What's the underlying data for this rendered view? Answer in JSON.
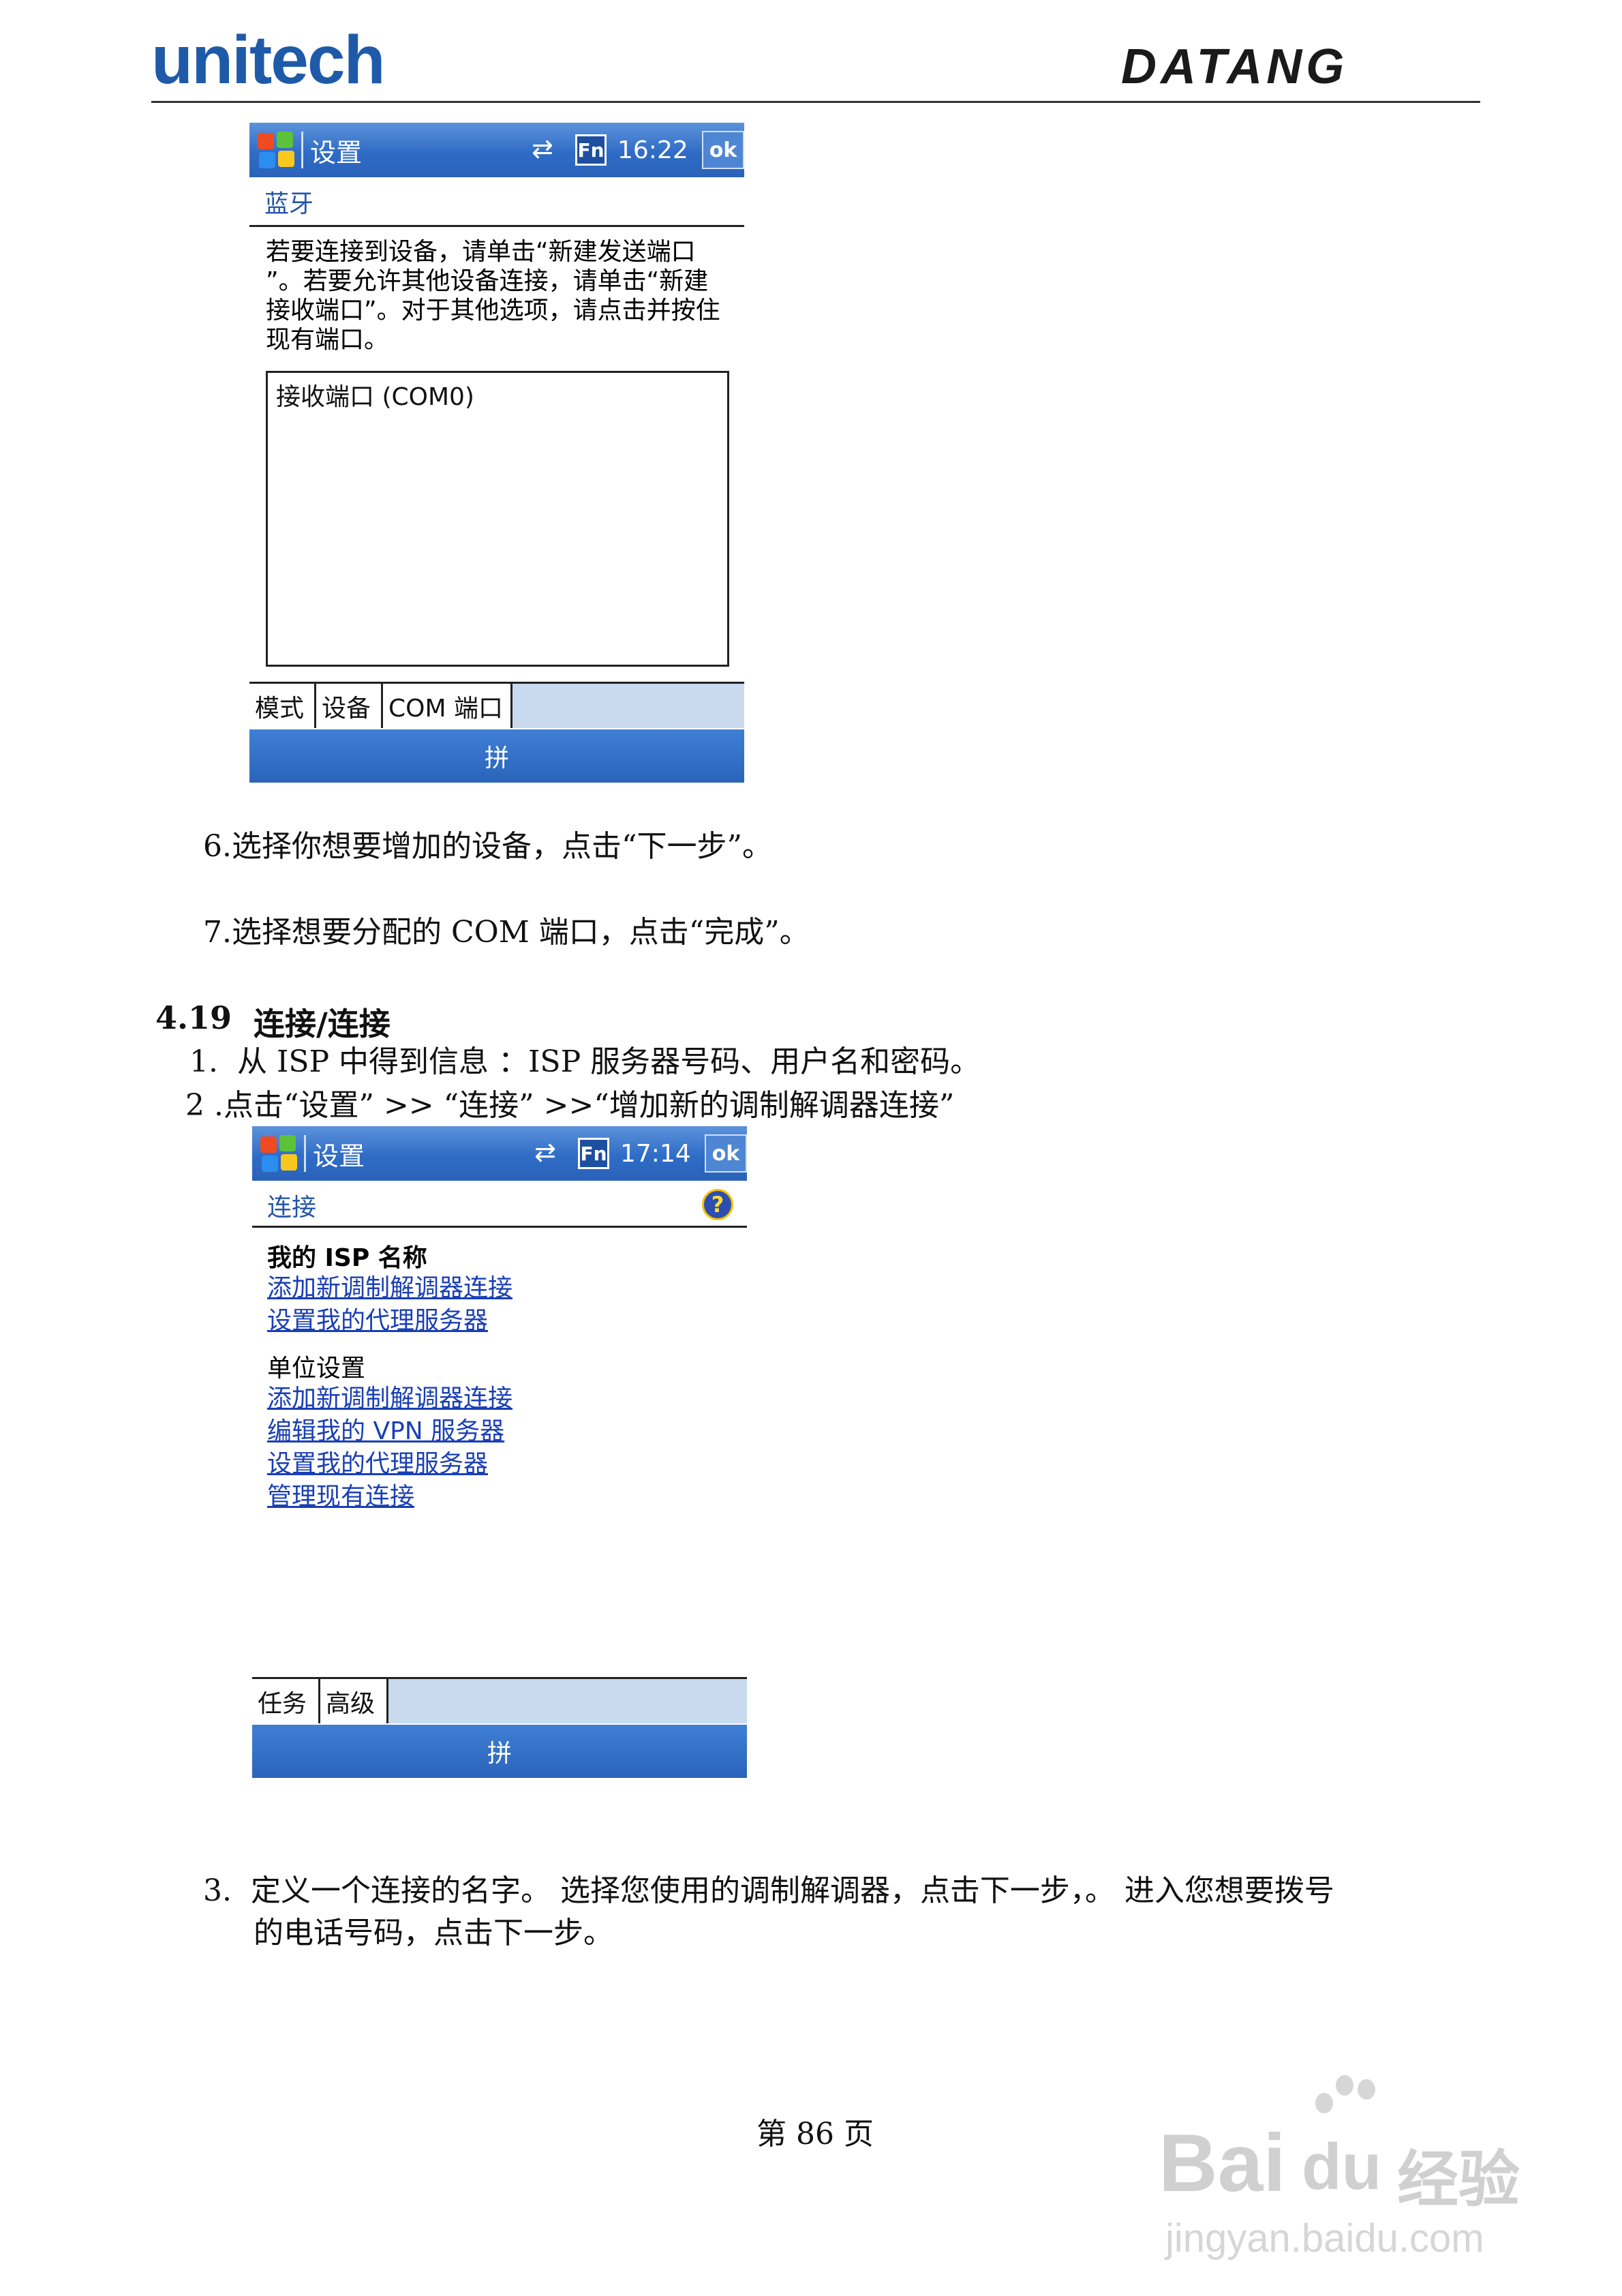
{
  "header": {
    "left_logo": "unitech",
    "right_logo": "DATANG"
  },
  "screen1": {
    "title": "设置",
    "sync_icon": "sync-arrows-icon",
    "fn_label": "Fn",
    "time": "16:22",
    "ok_label": "ok",
    "section": "蓝牙",
    "paragraph_lines": [
      "若要连接到设备，请单击“新建发送端口",
      "”。若要允许其他设备连接，请单击“新建",
      "接收端口”。对于其他选项，请点击并按住",
      "现有端口。"
    ],
    "list_item": "接收端口 (COM0)",
    "tabs": [
      "模式",
      "设备",
      "COM 端口"
    ],
    "menu": "拼"
  },
  "body": {
    "step6": "6.选择你想要增加的设备，点击“下一步”。",
    "step7": "7.选择想要分配的 COM 端口，点击“完成”。",
    "section_number": "4.19",
    "section_title": "连接/连接",
    "item1": "1.  从 ISP 中得到信息 ：ISP 服务器号码、用户名和密码。",
    "item2": "2 .点击“设置” >> “连接” >>“增加新的调制解调器连接”",
    "item3_line1": "3.  定义一个连接的名字。 选择您使用的调制解调器，点击下一步，。 进入您想要拨号",
    "item3_line2": "的电话号码，点击下一步。"
  },
  "screen2": {
    "title": "设置",
    "fn_label": "Fn",
    "time": "17:14",
    "ok_label": "ok",
    "section": "连接",
    "help_icon": "help-question-icon",
    "help_glyph": "?",
    "group1_title": "我的 ISP 名称",
    "group1_links": [
      "添加新调制解调器连接",
      "设置我的代理服务器"
    ],
    "group2_title": "单位设置",
    "group2_links": [
      "添加新调制解调器连接",
      "编辑我的 VPN 服务器",
      "设置我的代理服务器",
      "管理现有连接"
    ],
    "tabs": [
      "任务",
      "高级"
    ],
    "menu": "拼"
  },
  "footer": {
    "page": "第 86 页",
    "watermark_brand": "Bai",
    "watermark_du": "du",
    "watermark_jy": "经验",
    "watermark_url": "jingyan.baidu.com"
  },
  "colors": {
    "brand_blue": "#1e5aa8",
    "titlebar_blue": "#2f6cc6",
    "link_blue": "#1a3fb4"
  }
}
